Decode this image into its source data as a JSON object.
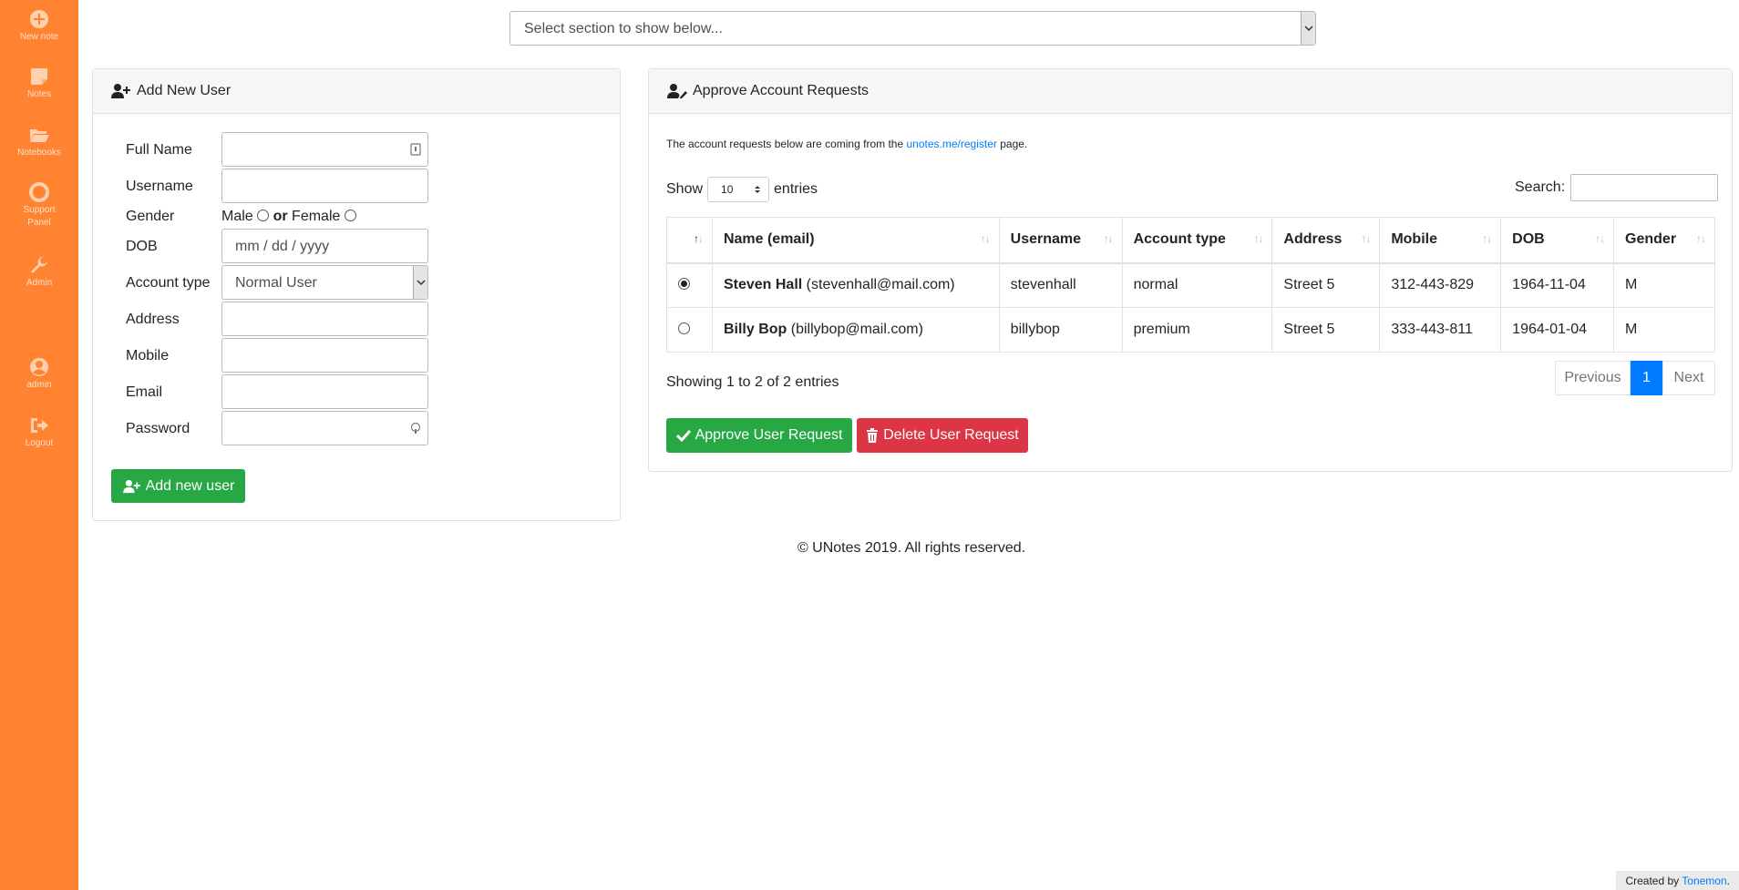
{
  "sidebar": {
    "items": [
      {
        "label": "New note",
        "icon": "plus-circle-icon"
      },
      {
        "label": "Notes",
        "icon": "sticky-note-icon"
      },
      {
        "label": "Notebooks",
        "icon": "folder-open-icon"
      },
      {
        "label": "Support",
        "label2": "Panel",
        "icon": "life-ring-icon"
      },
      {
        "label": "Admin",
        "icon": "wrench-icon"
      },
      {
        "label": "admin",
        "icon": "user-circle-icon"
      },
      {
        "label": "Logout",
        "icon": "sign-out-icon"
      }
    ],
    "color": "#ff8330"
  },
  "section_select": {
    "value": "Select section to show below..."
  },
  "add_user": {
    "title": "Add New User",
    "labels": {
      "full_name": "Full Name",
      "username": "Username",
      "gender": "Gender",
      "dob": "DOB",
      "account_type": "Account type",
      "address": "Address",
      "mobile": "Mobile",
      "email": "Email",
      "password": "Password"
    },
    "gender_male": "Male",
    "gender_or": "or",
    "gender_female": "Female",
    "dob_placeholder": "mm / dd / yyyy",
    "account_type_value": "Normal User",
    "submit_label": "Add new user"
  },
  "approve": {
    "title": "Approve Account Requests",
    "intro_before": "The account requests below are coming from the",
    "intro_link": "unotes.me/register",
    "intro_after": "page.",
    "show_label": "Show",
    "show_value": "10",
    "entries_label": "entries",
    "search_label": "Search:",
    "columns": [
      "Name (email)",
      "Username",
      "Account type",
      "Address",
      "Mobile",
      "DOB",
      "Gender"
    ],
    "rows": [
      {
        "selected": true,
        "name": "Steven Hall",
        "email": "(stevenhall@mail.com)",
        "username": "stevenhall",
        "account_type": "normal",
        "address": "Street 5",
        "mobile": "312-443-829",
        "dob": "1964-11-04",
        "gender": "M"
      },
      {
        "selected": false,
        "name": "Billy Bop",
        "email": "(billybop@mail.com)",
        "username": "billybop",
        "account_type": "premium",
        "address": "Street 5",
        "mobile": "333-443-811",
        "dob": "1964-01-04",
        "gender": "M"
      }
    ],
    "info": "Showing 1 to 2 of 2 entries",
    "pagination": {
      "previous": "Previous",
      "current": "1",
      "next": "Next"
    },
    "approve_label": "Approve User Request",
    "delete_label": "Delete User Request"
  },
  "footer": {
    "copyright": "© UNotes 2019. All rights reserved.",
    "credit_prefix": "Created by",
    "credit_link": "Tonemon",
    "credit_suffix": "."
  },
  "colors": {
    "accent": "#ff8330",
    "success": "#28a745",
    "danger": "#dc3545",
    "primary": "#007bff"
  }
}
